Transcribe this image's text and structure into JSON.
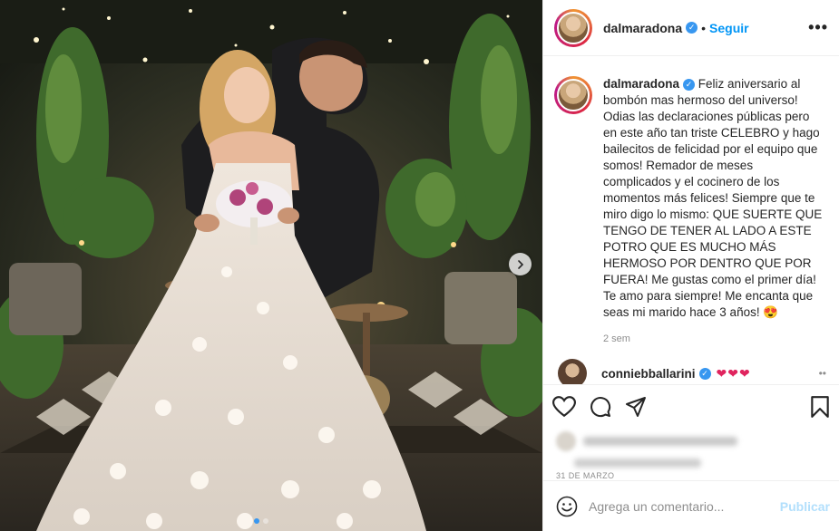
{
  "post": {
    "username": "dalmaradona",
    "follow_label": "Seguir",
    "separator": "•"
  },
  "caption": {
    "username": "dalmaradona",
    "text": "Feliz aniversario al bombón mas hermoso del universo! Odias las declaraciones públicas pero en este año tan triste CELEBRO y hago bailecitos de felicidad por el equipo que somos! Remador de meses complicados y el cocinero de los momentos más felices! Siempre que te miro digo lo mismo: QUE SUERTE QUE TENGO DE TENER AL LADO A ESTE POTRO QUE ES MUCHO MÁS HERMOSO POR DENTRO QUE POR FUERA! Me gustas como el primer día! Te amo para siempre! Me encanta que seas mi marido hace 3 años! 😍",
    "time": "2 sem"
  },
  "comment2": {
    "username": "conniebballarini",
    "emojis": "❤❤❤"
  },
  "meta": {
    "date": "31 DE MARZO"
  },
  "add_comment": {
    "placeholder": "Agrega un comentario...",
    "publish_label": "Publicar"
  },
  "carousel": {
    "total_slides": 2,
    "active_index": 0
  },
  "icons": {
    "more": "more-options-icon",
    "verified": "verified-badge-icon",
    "like": "heart-icon",
    "comment": "comment-icon",
    "share": "share-icon",
    "save": "bookmark-icon",
    "emoji": "emoji-icon",
    "next": "chevron-right-icon"
  },
  "colors": {
    "accent": "#0095f6",
    "verified": "#3897f0",
    "publish_disabled": "#b2dffc",
    "heart": "#e0245e"
  }
}
